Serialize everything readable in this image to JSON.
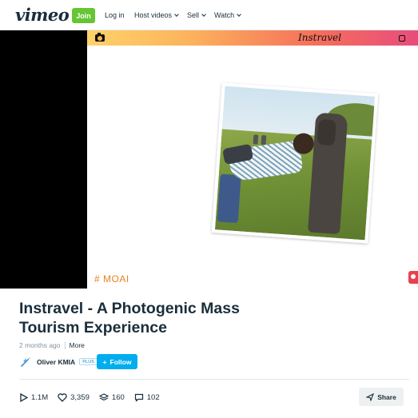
{
  "header": {
    "logo": "vimeo",
    "join_label": "Join",
    "nav": {
      "login": "Log in",
      "host_videos": "Host videos",
      "sell": "Sell",
      "watch": "Watch"
    }
  },
  "video": {
    "brand": "Instravel",
    "hashtag": "# MOAI"
  },
  "clip": {
    "title": "Instravel - A Photogenic Mass Tourism Experience",
    "posted": "2 months ago",
    "more_label": "More"
  },
  "owner": {
    "name": "Oliver KMIA",
    "badge": "PLUS",
    "follow_label": "Follow"
  },
  "stats": {
    "plays": "1.1M",
    "likes": "3,359",
    "collections": "160",
    "comments": "102",
    "share_label": "Share"
  },
  "colors": {
    "join_green": "#65c533",
    "follow_blue": "#00adef",
    "hashtag_orange": "#e9831c",
    "text_dark": "#1a2e3b"
  }
}
